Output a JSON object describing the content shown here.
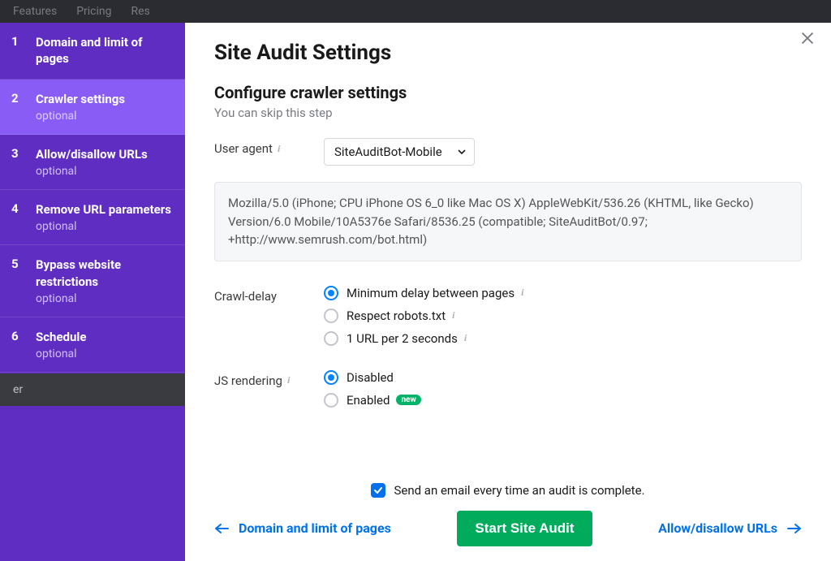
{
  "top_nav": {
    "items": [
      "Features",
      "Pricing",
      "Res"
    ]
  },
  "sidebar": {
    "items": [
      {
        "num": "1",
        "label": "Domain and limit of pages",
        "sublabel": "",
        "active": false
      },
      {
        "num": "2",
        "label": "Crawler settings",
        "sublabel": "optional",
        "active": true
      },
      {
        "num": "3",
        "label": "Allow/disallow URLs",
        "sublabel": "optional",
        "active": false
      },
      {
        "num": "4",
        "label": "Remove URL parameters",
        "sublabel": "optional",
        "active": false
      },
      {
        "num": "5",
        "label": "Bypass website restrictions",
        "sublabel": "optional",
        "active": false
      },
      {
        "num": "6",
        "label": "Schedule",
        "sublabel": "optional",
        "active": false
      }
    ]
  },
  "below_sidebar_text": "er",
  "main": {
    "title": "Site Audit Settings",
    "subtitle": "Configure crawler settings",
    "hint": "You can skip this step",
    "user_agent": {
      "label": "User agent",
      "selected": "SiteAuditBot-Mobile",
      "ua_string": "Mozilla/5.0 (iPhone; CPU iPhone OS 6_0 like Mac OS X) AppleWebKit/536.26 (KHTML, like Gecko) Version/6.0 Mobile/10A5376e Safari/8536.25 (compatible; SiteAuditBot/0.97; +http://www.semrush.com/bot.html)"
    },
    "crawl_delay": {
      "label": "Crawl-delay",
      "options": [
        {
          "label": "Minimum delay between pages",
          "checked": true,
          "info": true
        },
        {
          "label": "Respect robots.txt",
          "checked": false,
          "info": true
        },
        {
          "label": "1 URL per 2 seconds",
          "checked": false,
          "info": true
        }
      ]
    },
    "js_rendering": {
      "label": "JS rendering",
      "options": [
        {
          "label": "Disabled",
          "checked": true,
          "badge": ""
        },
        {
          "label": "Enabled",
          "checked": false,
          "badge": "new"
        }
      ]
    },
    "email": {
      "checked": true,
      "label": "Send an email every time an audit is complete."
    },
    "actions": {
      "prev": "Domain and limit of pages",
      "primary": "Start Site Audit",
      "next": "Allow/disallow URLs"
    }
  }
}
